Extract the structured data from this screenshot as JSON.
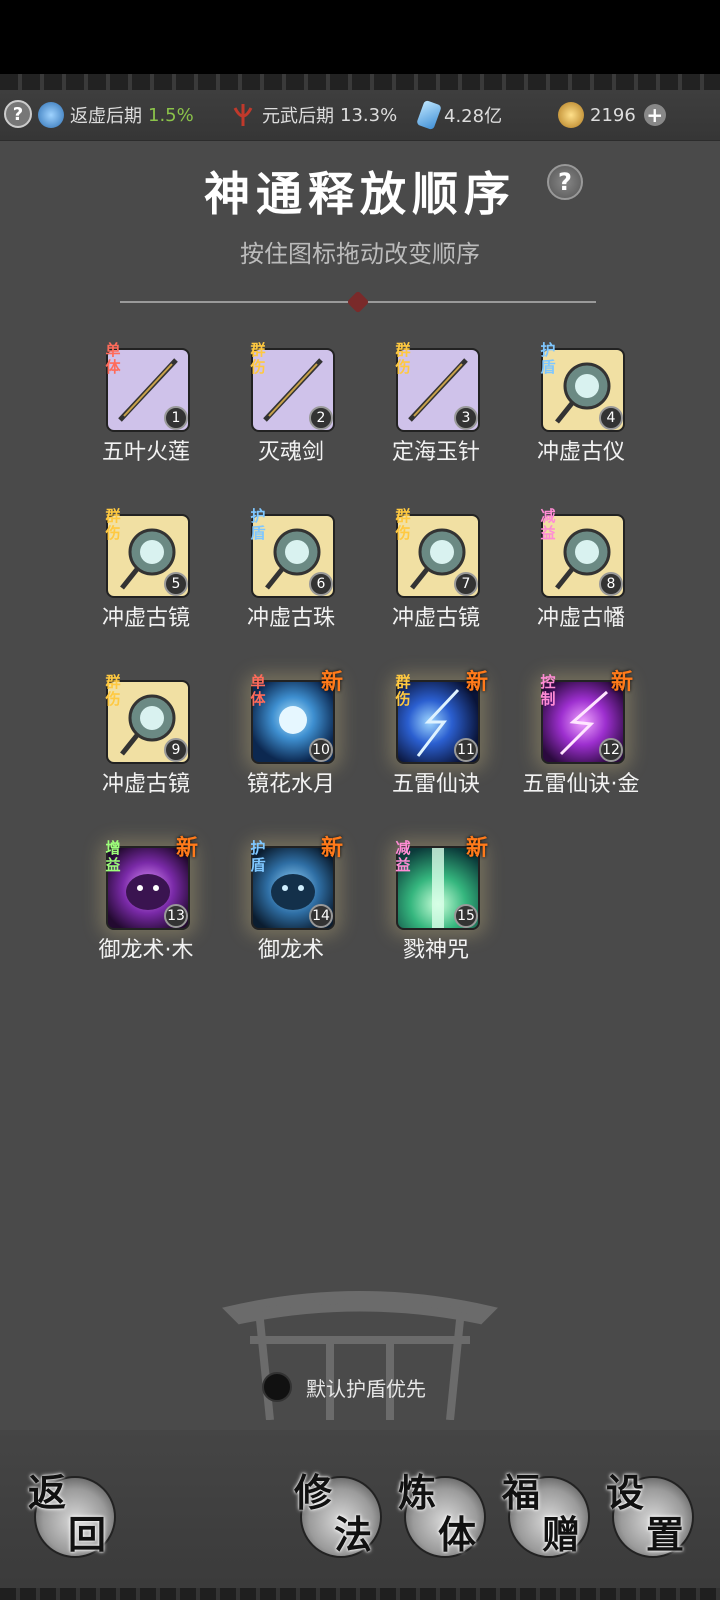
{
  "status": {
    "help": "?",
    "realm1": {
      "name": "返虚后期",
      "pct": "1.5%"
    },
    "realm2": {
      "name": "元武后期",
      "pct": "13.3%"
    },
    "crystal": "4.28亿",
    "coins": "2196",
    "plus": "+"
  },
  "header": {
    "title": "神通释放顺序",
    "help": "?",
    "subtitle": "按住图标拖动改变顺序"
  },
  "skills": [
    {
      "tag": "单\n体",
      "tag_type": "single",
      "name": "五叶火莲",
      "num": "1",
      "new": "",
      "icon": "lotus-icon",
      "bg": "purple"
    },
    {
      "tag": "群\n伤",
      "tag_type": "group",
      "name": "灭魂剑",
      "num": "2",
      "new": "",
      "icon": "sword-icon",
      "bg": "purple"
    },
    {
      "tag": "群\n伤",
      "tag_type": "group",
      "name": "定海玉针",
      "num": "3",
      "new": "",
      "icon": "needle-icon",
      "bg": "purple"
    },
    {
      "tag": "护\n盾",
      "tag_type": "shield",
      "name": "冲虚古仪",
      "num": "4",
      "new": "",
      "icon": "bagua-mirror-icon",
      "bg": "yellow"
    },
    {
      "tag": "群\n伤",
      "tag_type": "group",
      "name": "冲虚古镜",
      "num": "5",
      "new": "",
      "icon": "mirror-icon",
      "bg": "yellow"
    },
    {
      "tag": "护\n盾",
      "tag_type": "shield",
      "name": "冲虚古珠",
      "num": "6",
      "new": "",
      "icon": "orb-icon",
      "bg": "yellow"
    },
    {
      "tag": "群\n伤",
      "tag_type": "group",
      "name": "冲虚古镜",
      "num": "7",
      "new": "",
      "icon": "mirror-icon",
      "bg": "yellow"
    },
    {
      "tag": "减\n益",
      "tag_type": "debuff",
      "name": "冲虚古幡",
      "num": "8",
      "new": "",
      "icon": "banner-icon",
      "bg": "yellow"
    },
    {
      "tag": "群\n伤",
      "tag_type": "group",
      "name": "冲虚古镜",
      "num": "9",
      "new": "",
      "icon": "mirror-icon",
      "bg": "yellow"
    },
    {
      "tag": "单\n体",
      "tag_type": "single",
      "name": "镜花水月",
      "num": "10",
      "new": "新",
      "icon": "water-flower-icon",
      "bg": "blue"
    },
    {
      "tag": "群\n伤",
      "tag_type": "group",
      "name": "五雷仙诀",
      "num": "11",
      "new": "新",
      "icon": "lightning-icon",
      "bg": "lightning"
    },
    {
      "tag": "控\n制",
      "tag_type": "control",
      "name": "五雷仙诀·金",
      "num": "12",
      "new": "新",
      "icon": "lightning-purple-icon",
      "bg": "violet"
    },
    {
      "tag": "增\n益",
      "tag_type": "buff",
      "name": "御龙术·木",
      "num": "13",
      "new": "新",
      "icon": "dragon-purple-icon",
      "bg": "dragonp"
    },
    {
      "tag": "护\n盾",
      "tag_type": "shield",
      "name": "御龙术",
      "num": "14",
      "new": "新",
      "icon": "dragon-blue-icon",
      "bg": "dragonb"
    },
    {
      "tag": "减\n益",
      "tag_type": "debuff",
      "name": "戮神咒",
      "num": "15",
      "new": "新",
      "icon": "green-beam-icon",
      "bg": "green"
    }
  ],
  "toggle": {
    "label": "默认护盾优先",
    "checked": false
  },
  "bottom": {
    "back": [
      "返",
      "回"
    ],
    "cultivate": [
      "修",
      "法"
    ],
    "refine": [
      "炼",
      "体"
    ],
    "gift": [
      "福",
      "赠"
    ],
    "settings": [
      "设",
      "置"
    ]
  }
}
